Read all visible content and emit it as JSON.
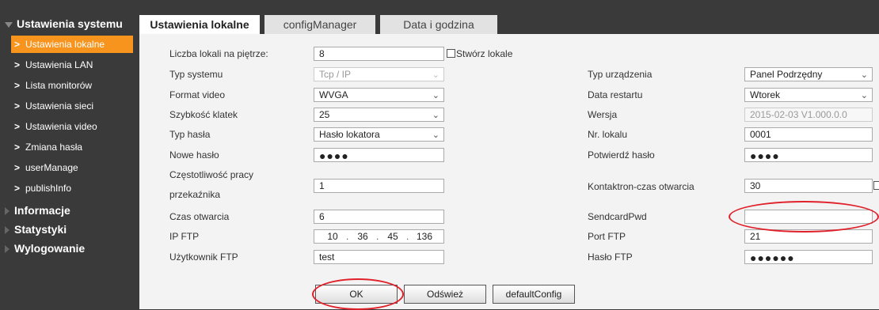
{
  "sidebar": {
    "title": "Ustawienia systemu",
    "items": [
      {
        "label": "Ustawienia lokalne",
        "active": true
      },
      {
        "label": "Ustawienia LAN"
      },
      {
        "label": "Lista monitorów"
      },
      {
        "label": "Ustawienia sieci"
      },
      {
        "label": "Ustawienia video"
      },
      {
        "label": "Zmiana hasła"
      },
      {
        "label": "userManage"
      },
      {
        "label": "publishInfo"
      }
    ],
    "groups": [
      "Informacje",
      "Statystyki",
      "Wylogowanie"
    ]
  },
  "tabs": [
    "Ustawienia lokalne",
    "configManager",
    "Data i godzina"
  ],
  "form": {
    "liczba_lokali": {
      "label": "Liczba lokali na piętrze:",
      "value": "8"
    },
    "stworz_lokale": {
      "label": "Stwórz lokale"
    },
    "typ_systemu": {
      "label": "Typ systemu",
      "value": "Tcp / IP"
    },
    "format_video": {
      "label": "Format video",
      "value": "WVGA"
    },
    "szybkosc_klatek": {
      "label": "Szybkość klatek",
      "value": "25"
    },
    "typ_hasla": {
      "label": "Typ hasła",
      "value": "Hasło lokatora"
    },
    "nowe_haslo": {
      "label": "Nowe hasło",
      "value": "●●●●"
    },
    "czestotliwosc_line1": "Częstotliwość pracy",
    "czestotliwosc_line2": "przekaźnika",
    "czestotliwosc_value": "1",
    "czas_otwarcia": {
      "label": "Czas otwarcia",
      "value": "6"
    },
    "ip_ftp": {
      "label": "IP FTP",
      "octets": [
        "10",
        "36",
        "45",
        "136"
      ],
      "sep": "."
    },
    "uzytkownik_ftp": {
      "label": "Użytkownik FTP",
      "value": "test"
    },
    "typ_urzadzenia": {
      "label": "Typ urządzenia",
      "value": "Panel Podrzędny"
    },
    "data_restartu": {
      "label": "Data restartu",
      "value": "Wtorek"
    },
    "wersja": {
      "label": "Wersja",
      "value": "2015-02-03 V1.000.0.0"
    },
    "nr_lokalu": {
      "label": "Nr. lokalu",
      "value": "0001"
    },
    "potwierdz_haslo": {
      "label": "Potwierdź hasło",
      "value": "●●●●"
    },
    "kontaktron": {
      "label": "Kontaktron-czas otwarcia",
      "value": "30"
    },
    "sendcard": {
      "label": "SendcardPwd",
      "value": ""
    },
    "port_ftp": {
      "label": "Port FTP",
      "value": "21"
    },
    "haslo_ftp": {
      "label": "Hasło FTP",
      "value": "●●●●●●"
    }
  },
  "buttons": {
    "ok": "OK",
    "odswiez": "Odśwież",
    "default": "defaultConfig"
  },
  "icons": {
    "dropdown": "⌄",
    "menu_chevron": ">"
  },
  "colors": {
    "accent": "#f7941d",
    "annotation": "#e0202a"
  }
}
